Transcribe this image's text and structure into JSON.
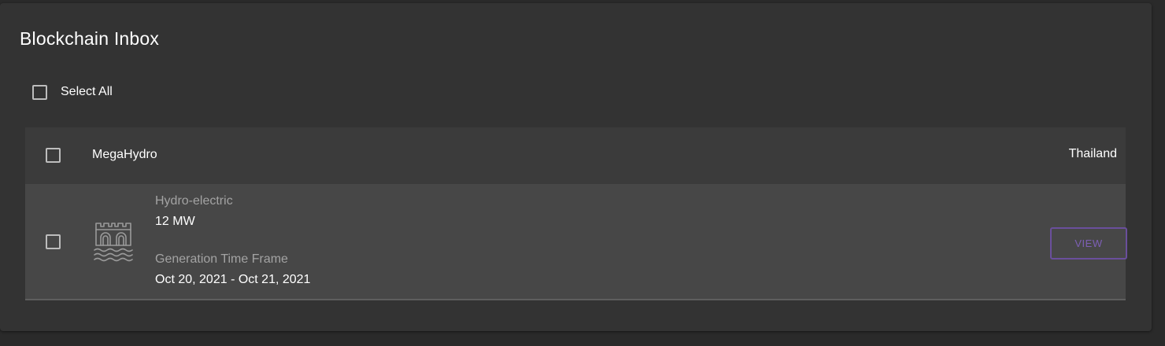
{
  "page": {
    "title": "Blockchain Inbox"
  },
  "select_all": {
    "label": "Select All",
    "checked": false
  },
  "groups": [
    {
      "name": "MegaHydro",
      "country": "Thailand",
      "checked": false,
      "items": [
        {
          "checked": false,
          "icon": "hydro-dam-icon",
          "type": "Hydro-electric",
          "capacity": "12 MW",
          "timeframe_label": "Generation Time Frame",
          "timeframe": "Oct 20, 2021 - Oct 21, 2021",
          "action_label": "VIEW"
        }
      ]
    }
  ],
  "colors": {
    "background": "#2a2a2a",
    "panel": "#333333",
    "group_header": "#3b3b3b",
    "item_row": "#474747",
    "accent": "#6a4f9c"
  }
}
